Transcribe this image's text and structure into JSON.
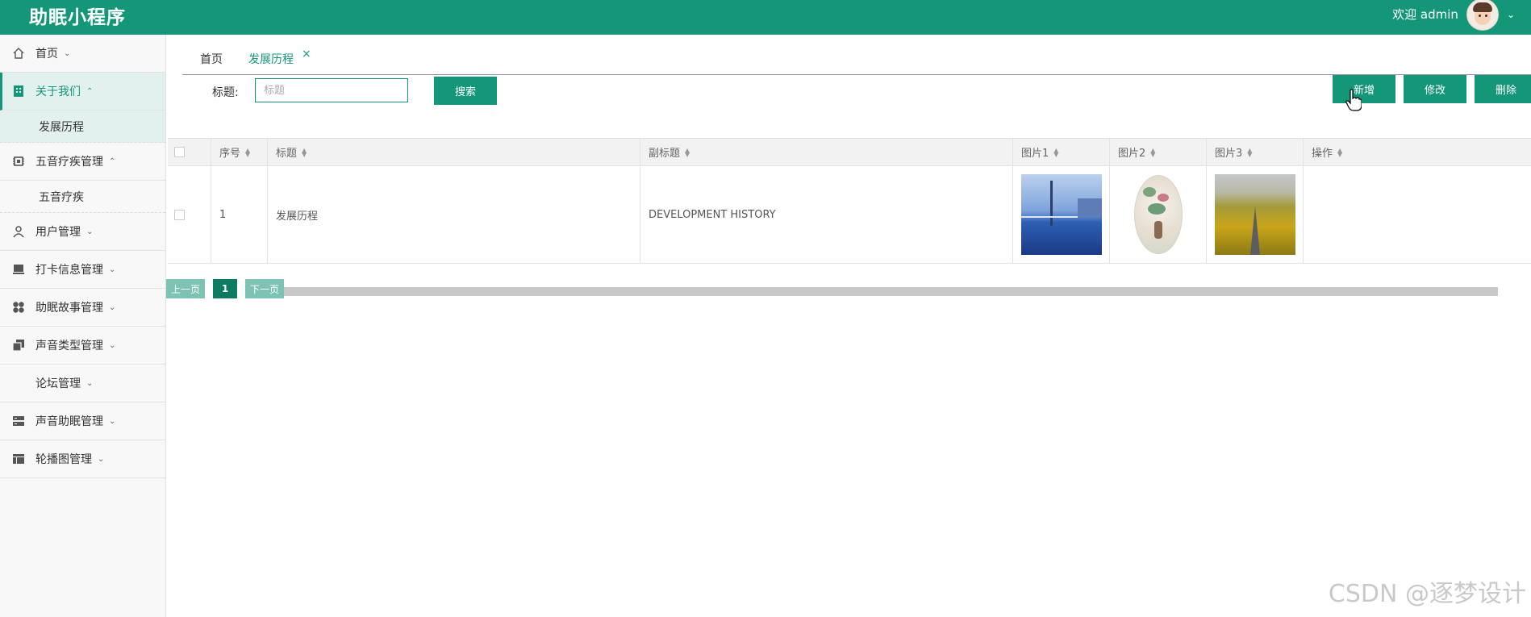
{
  "header": {
    "app_title": "助眠小程序",
    "welcome": "欢迎 admin"
  },
  "sidebar": {
    "items": [
      {
        "label": "首页",
        "icon": "home-icon"
      },
      {
        "label": "关于我们",
        "icon": "building-icon"
      },
      {
        "label": "五音疗疾管理",
        "icon": "chip-icon"
      },
      {
        "label": "用户管理",
        "icon": "user-icon"
      },
      {
        "label": "打卡信息管理",
        "icon": "laptop-icon"
      },
      {
        "label": "助眠故事管理",
        "icon": "apps-icon"
      },
      {
        "label": "声音类型管理",
        "icon": "copy-icon"
      },
      {
        "label": "论坛管理",
        "icon": ""
      },
      {
        "label": "声音助眠管理",
        "icon": "server-icon"
      },
      {
        "label": "轮播图管理",
        "icon": "layout-icon"
      }
    ],
    "sub_about": "发展历程",
    "sub_music": "五音疗疾"
  },
  "tabs": {
    "home": "首页",
    "current": "发展历程"
  },
  "search": {
    "label": "标题:",
    "placeholder": "标题",
    "button": "搜索"
  },
  "actions": {
    "add": "新增",
    "edit": "修改",
    "delete": "删除"
  },
  "table": {
    "columns": [
      "序号",
      "标题",
      "副标题",
      "图片1",
      "图片2",
      "图片3",
      "操作"
    ],
    "rows": [
      {
        "no": "1",
        "title": "发展历程",
        "subtitle": "DEVELOPMENT HISTORY"
      }
    ]
  },
  "pager": {
    "prev": "上一页",
    "current": "1",
    "next": "下一页"
  },
  "watermark": "CSDN @逐梦设计",
  "colors": {
    "primary": "#149778",
    "primary_dark": "#0e7a62",
    "pager_light": "#7cc3b3"
  }
}
